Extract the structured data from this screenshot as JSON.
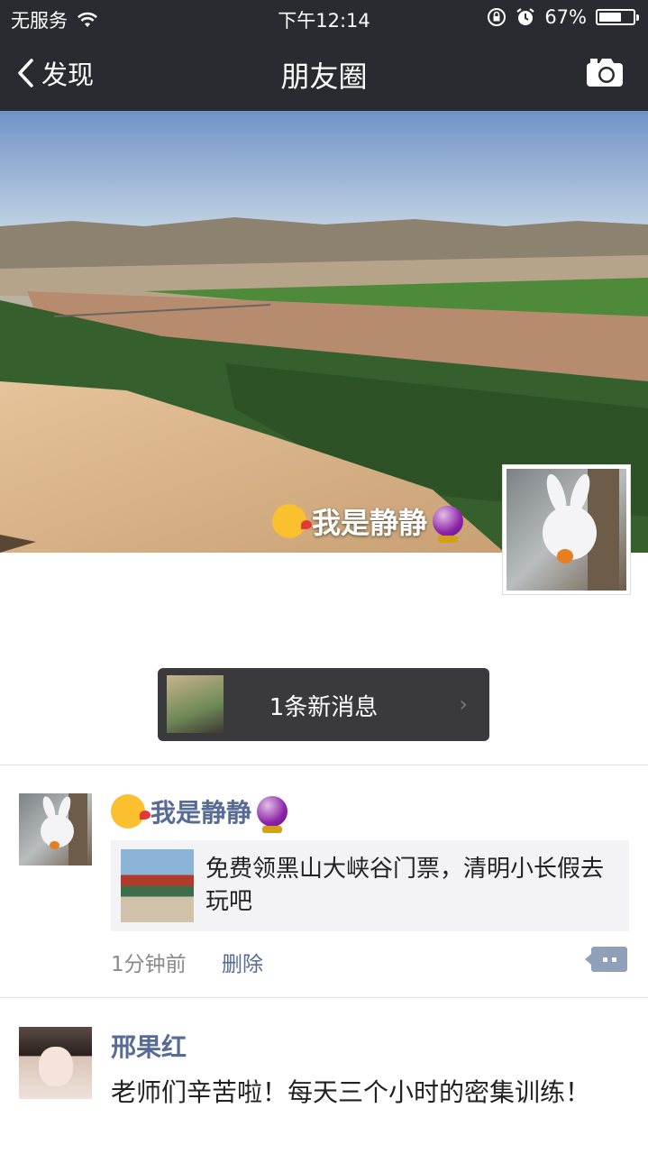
{
  "status_bar": {
    "carrier": "无服务",
    "time": "下午12:14",
    "battery_percent": "67%",
    "battery_level": 0.67
  },
  "nav": {
    "back_label": "发现",
    "title": "朋友圈"
  },
  "cover": {
    "user_name": "我是静静"
  },
  "new_message": {
    "text": "1条新消息"
  },
  "posts": [
    {
      "user_name": "我是静静",
      "share_text": "免费领黑山大峡谷门票，清明小长假去玩吧",
      "time": "1分钟前",
      "delete_label": "删除"
    },
    {
      "user_name": "邢果红",
      "text": "老师们辛苦啦！每天三个小时的密集训练！"
    }
  ],
  "colors": {
    "nav_bg": "#2a2b30",
    "link_blue": "#576b95"
  }
}
